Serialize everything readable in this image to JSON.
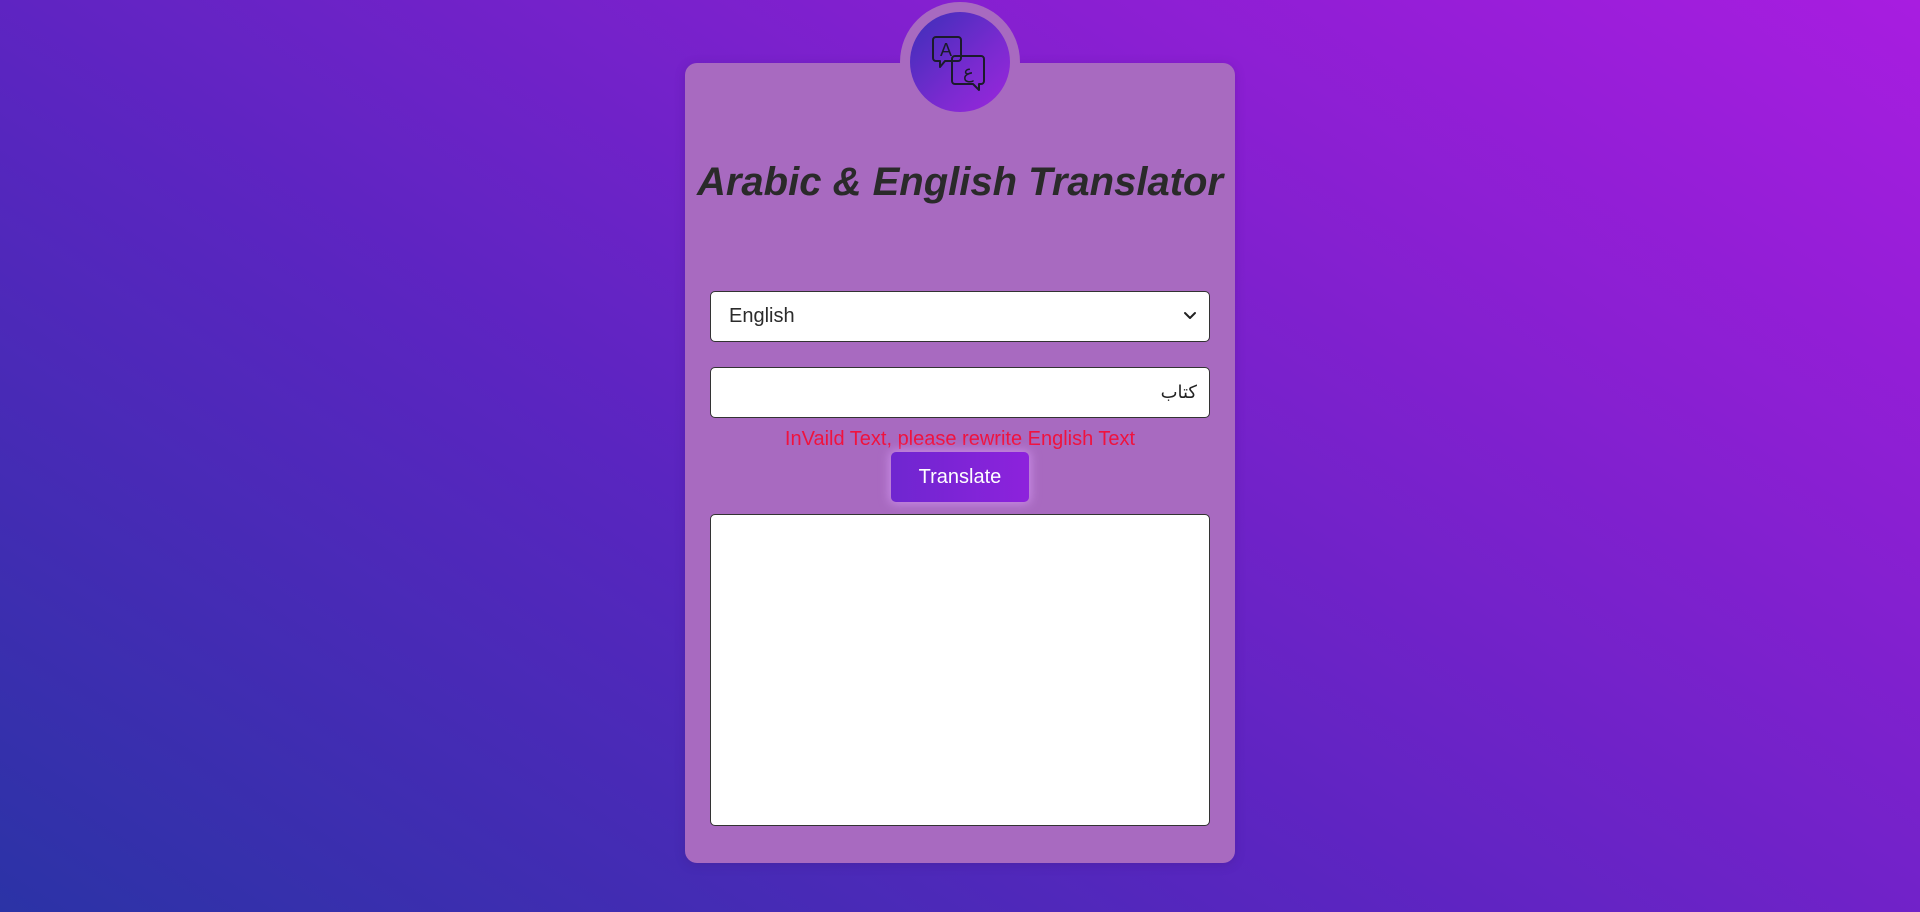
{
  "app": {
    "title": "Arabic & English Translator"
  },
  "logo": {
    "icon": "translate-icon",
    "latin_glyph": "A",
    "arabic_glyph": "ع"
  },
  "language_select": {
    "selected": "English",
    "icon": "chevron-down-icon"
  },
  "text_input": {
    "value": "كتاب"
  },
  "error": {
    "message": "InVaild Text, please rewrite English Text"
  },
  "translate_button": {
    "label": "Translate"
  },
  "output": {
    "value": ""
  },
  "colors": {
    "card_bg": "#a86ac0",
    "error_red": "#f0123e",
    "button_gradient_start": "#6f26d0",
    "button_gradient_end": "#8d22dc",
    "title_text": "#2a2a2a"
  }
}
